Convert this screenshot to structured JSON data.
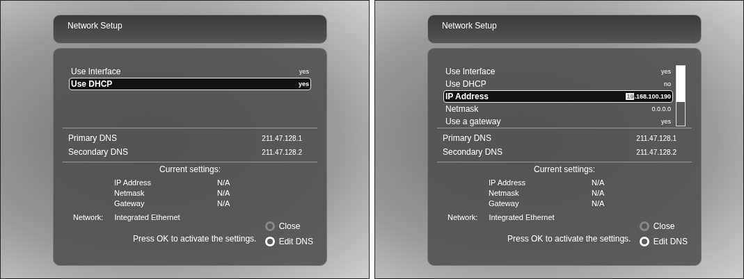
{
  "screens": [
    {
      "title": "Network Setup",
      "settings": {
        "rows": [
          {
            "label": "Use Interface",
            "value": "yes",
            "selected": false
          },
          {
            "label": "Use DHCP",
            "value": "yes",
            "selected": true
          }
        ]
      },
      "dns": [
        {
          "label": "Primary DNS",
          "value": "211.47.128.1"
        },
        {
          "label": "Secondary DNS",
          "value": "211.47.128.2"
        }
      ],
      "current_settings": {
        "heading": "Current settings:",
        "rows": [
          {
            "label": "IP Address",
            "value": "N/A"
          },
          {
            "label": "Netmask",
            "value": "N/A"
          },
          {
            "label": "Gateway",
            "value": "N/A"
          }
        ]
      },
      "network": {
        "label": "Network:",
        "value": "Integrated Ethernet"
      },
      "hint": "Press OK to activate the settings.",
      "buttons": [
        {
          "label": "Close",
          "selected": false
        },
        {
          "label": "Edit DNS",
          "selected": true
        }
      ]
    },
    {
      "title": "Network Setup",
      "settings": {
        "scrollbar": true,
        "rows": [
          {
            "label": "Use Interface",
            "value": "yes",
            "selected": false
          },
          {
            "label": "Use DHCP",
            "value": "no",
            "selected": false
          },
          {
            "label": "IP Address",
            "cursor": "19",
            "value": ".168.100.190",
            "selected": true
          },
          {
            "label": "Netmask",
            "value": "0.0.0.0",
            "selected": false
          },
          {
            "label": "Use a gateway",
            "value": "yes",
            "selected": false
          }
        ]
      },
      "dns": [
        {
          "label": "Primary DNS",
          "value": "211.47.128.1"
        },
        {
          "label": "Secondary DNS",
          "value": "211.47.128.2"
        }
      ],
      "current_settings": {
        "heading": "Current settings:",
        "rows": [
          {
            "label": "IP Address",
            "value": "N/A"
          },
          {
            "label": "Netmask",
            "value": "N/A"
          },
          {
            "label": "Gateway",
            "value": "N/A"
          }
        ]
      },
      "network": {
        "label": "Network:",
        "value": "Integrated Ethernet"
      },
      "hint": "Press OK to activate the settings.",
      "buttons": [
        {
          "label": "Close",
          "selected": false
        },
        {
          "label": "Edit DNS",
          "selected": true
        }
      ]
    }
  ]
}
